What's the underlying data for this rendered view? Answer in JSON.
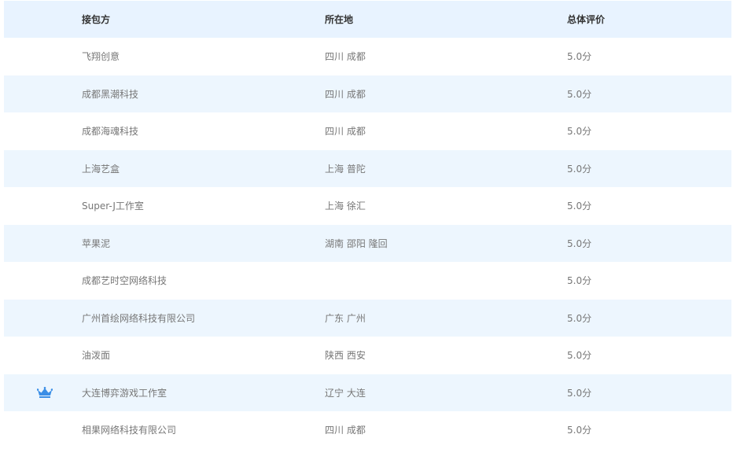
{
  "table": {
    "columns": {
      "name": "接包方",
      "location": "所在地",
      "rating": "总体评价"
    },
    "rows": [
      {
        "name": "飞翔创意",
        "location": "四川 成都",
        "rating": "5.0分",
        "crown": false
      },
      {
        "name": "成都黑潮科技",
        "location": "四川 成都",
        "rating": "5.0分",
        "crown": false
      },
      {
        "name": "成都海魂科技",
        "location": "四川 成都",
        "rating": "5.0分",
        "crown": false
      },
      {
        "name": "上海艺盒",
        "location": "上海 普陀",
        "rating": "5.0分",
        "crown": false
      },
      {
        "name": "Super-J工作室",
        "location": "上海 徐汇",
        "rating": "5.0分",
        "crown": false
      },
      {
        "name": "苹果泥",
        "location": "湖南 邵阳 隆回",
        "rating": "5.0分",
        "crown": false
      },
      {
        "name": "成都艺时空网络科技",
        "location": "",
        "rating": "5.0分",
        "crown": false
      },
      {
        "name": "广州首绘网络科技有限公司",
        "location": "广东 广州",
        "rating": "5.0分",
        "crown": false
      },
      {
        "name": "油泼面",
        "location": "陕西 西安",
        "rating": "5.0分",
        "crown": false
      },
      {
        "name": "大连博弈游戏工作室",
        "location": "辽宁 大连",
        "rating": "5.0分",
        "crown": true
      },
      {
        "name": "相果网络科技有限公司",
        "location": "四川 成都",
        "rating": "5.0分",
        "crown": false
      }
    ]
  },
  "icons": {
    "crown": "crown-icon"
  },
  "colors": {
    "header_bg": "#e8f3ff",
    "alt_row_bg": "#edf6fe",
    "crown": "#3a8ee6"
  }
}
